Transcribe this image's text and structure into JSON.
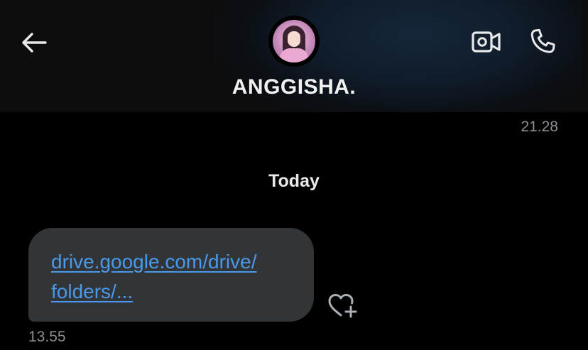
{
  "header": {
    "contact_name": "ANGGISHA.",
    "icons": {
      "back": "back-arrow-icon",
      "video": "video-call-icon",
      "call": "phone-call-icon",
      "avatar": "profile-avatar"
    }
  },
  "conversation": {
    "previous_message_time": "21.28",
    "day_separator": "Today",
    "messages": [
      {
        "link_line_1": "drive.google.com/drive/",
        "link_line_2": "folders/...",
        "time": "13.55",
        "reaction_icon": "heart-plus-icon"
      }
    ]
  },
  "colors": {
    "background": "#000000",
    "bubble": "#323538",
    "link": "#4a99e9",
    "timestamp": "#8b8f94"
  }
}
